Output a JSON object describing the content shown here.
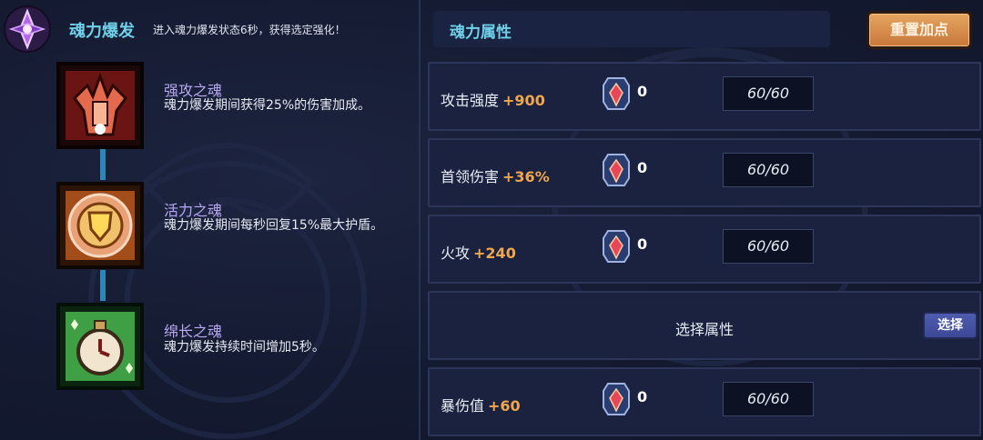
{
  "burst": {
    "title": "魂力爆发",
    "desc": "进入魂力爆发状态6秒，获得选定强化！",
    "icon": "purple-crystal-icon"
  },
  "souls": [
    {
      "name": "强攻之魂",
      "desc": "魂力爆发期间获得25%的伤害加成。",
      "icon": "red-fist-icon"
    },
    {
      "name": "活力之魂",
      "desc": "魂力爆发期间每秒回复15%最大护盾。",
      "icon": "gold-shield-icon"
    },
    {
      "name": "绵长之魂",
      "desc": "魂力爆发持续时间增加5秒。",
      "icon": "green-stopwatch-icon"
    }
  ],
  "attributes": {
    "title": "魂力属性",
    "reset_label": "重置加点",
    "rows": [
      {
        "name": "攻击强度",
        "bonus": "+900",
        "gems": "0",
        "cap": "60/60"
      },
      {
        "name": "首领伤害",
        "bonus": "+36%",
        "gems": "0",
        "cap": "60/60"
      },
      {
        "name": "火攻",
        "bonus": "+240",
        "gems": "0",
        "cap": "60/60"
      },
      {
        "name": "暴伤值",
        "bonus": "+60",
        "gems": "0",
        "cap": "60/60"
      }
    ],
    "select_slot": {
      "label": "选择属性",
      "button": "选择"
    }
  },
  "colors": {
    "accent": "#6fd0e8",
    "bonus": "#f0a64c",
    "soul_name": "#b8a8f2",
    "reset_button": "#d98d4b"
  }
}
